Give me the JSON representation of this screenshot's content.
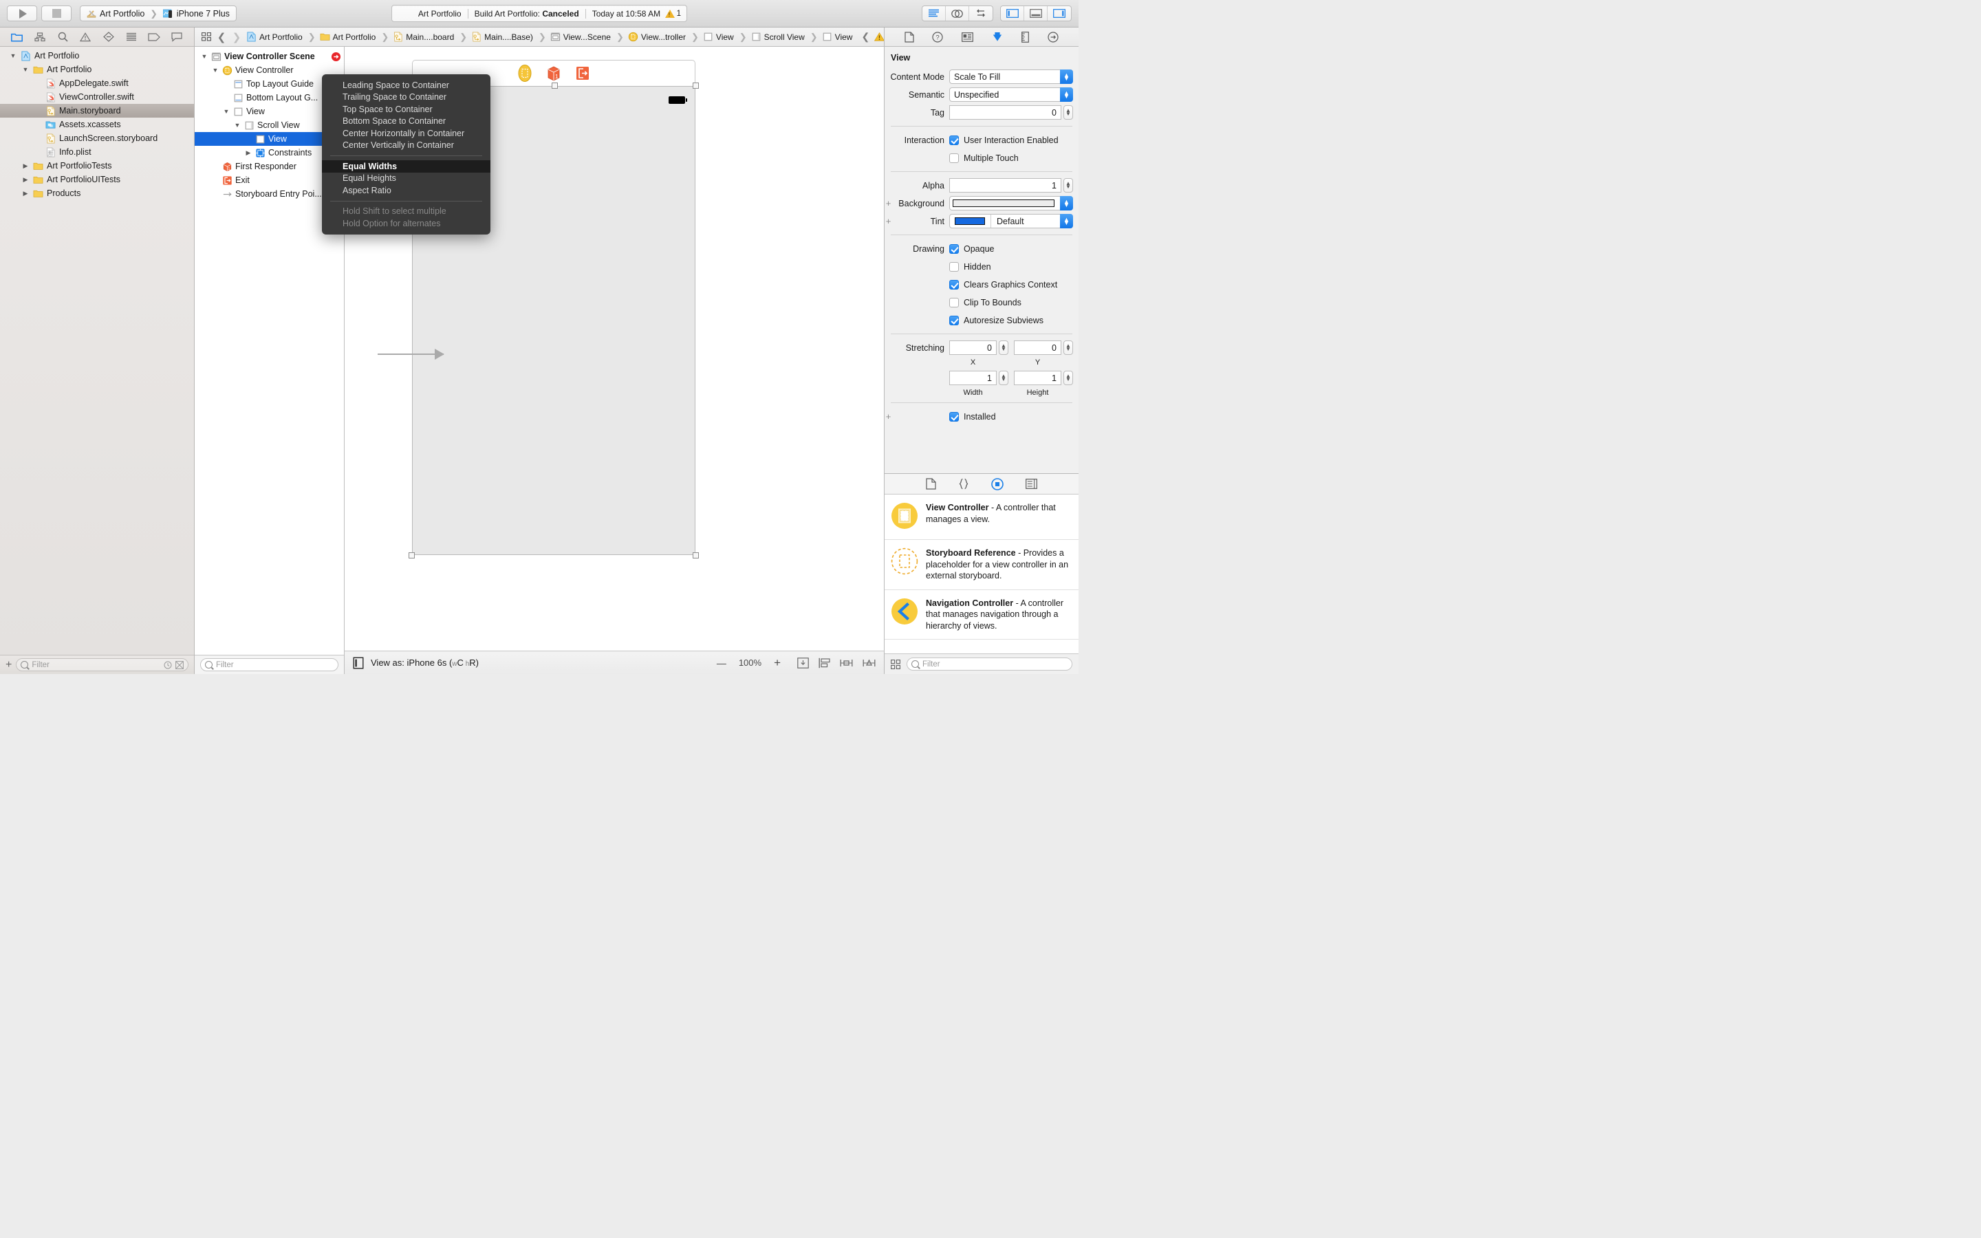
{
  "toolbar": {
    "run_button": "run",
    "stop_button": "stop",
    "scheme_name": "Art Portfolio",
    "destination_name": "iPhone 7 Plus",
    "status_project": "Art Portfolio",
    "status_build": "Build Art Portfolio: ",
    "status_build_result": "Canceled",
    "status_time": "Today at 10:58 AM",
    "warning_count": "1",
    "editor_buttons": [
      "standard-editor",
      "assistant-editor",
      "version-editor"
    ],
    "view_buttons": [
      "toggle-navigator",
      "toggle-debug-area",
      "toggle-utilities"
    ]
  },
  "navigator": {
    "tabs": [
      "project-navigator",
      "symbol-navigator",
      "find-navigator",
      "issue-navigator",
      "test-navigator",
      "debug-navigator",
      "breakpoint-navigator",
      "report-navigator"
    ],
    "items": [
      {
        "label": "Art Portfolio",
        "depth": 0,
        "disclosure": "open",
        "icon": "xcode-project",
        "selected": false
      },
      {
        "label": "Art Portfolio",
        "depth": 1,
        "disclosure": "open",
        "icon": "folder",
        "selected": false
      },
      {
        "label": "AppDelegate.swift",
        "depth": 2,
        "disclosure": "none",
        "icon": "swift",
        "selected": false
      },
      {
        "label": "ViewController.swift",
        "depth": 2,
        "disclosure": "none",
        "icon": "swift",
        "selected": false
      },
      {
        "label": "Main.storyboard",
        "depth": 2,
        "disclosure": "none",
        "icon": "storyboard",
        "selected": true
      },
      {
        "label": "Assets.xcassets",
        "depth": 2,
        "disclosure": "none",
        "icon": "xcassets",
        "selected": false
      },
      {
        "label": "LaunchScreen.storyboard",
        "depth": 2,
        "disclosure": "none",
        "icon": "storyboard",
        "selected": false
      },
      {
        "label": "Info.plist",
        "depth": 2,
        "disclosure": "none",
        "icon": "plist",
        "selected": false
      },
      {
        "label": "Art PortfolioTests",
        "depth": 1,
        "disclosure": "closed",
        "icon": "folder",
        "selected": false
      },
      {
        "label": "Art PortfolioUITests",
        "depth": 1,
        "disclosure": "closed",
        "icon": "folder",
        "selected": false
      },
      {
        "label": "Products",
        "depth": 1,
        "disclosure": "closed",
        "icon": "folder",
        "selected": false
      }
    ],
    "filter_placeholder": "Filter",
    "add_button": "+"
  },
  "jumpbar": {
    "crumbs": [
      {
        "label": "Art Portfolio",
        "icon": "xcode-project"
      },
      {
        "label": "Art Portfolio",
        "icon": "folder"
      },
      {
        "label": "Main....board",
        "icon": "storyboard"
      },
      {
        "label": "Main....Base)",
        "icon": "storyboard"
      },
      {
        "label": "View...Scene",
        "icon": "scene"
      },
      {
        "label": "View...troller",
        "icon": "view-controller"
      },
      {
        "label": "View",
        "icon": "view"
      },
      {
        "label": "Scroll View",
        "icon": "scroll-view"
      },
      {
        "label": "View",
        "icon": "view"
      }
    ],
    "warning_icon": "warning-triangle"
  },
  "outline": {
    "items": [
      {
        "label": "View Controller Scene",
        "depth": 0,
        "disclosure": "open",
        "icon": "scene",
        "bold": true,
        "selected": false,
        "badge": "entry-arrow"
      },
      {
        "label": "View Controller",
        "depth": 1,
        "disclosure": "open",
        "icon": "view-controller",
        "bold": false,
        "selected": false
      },
      {
        "label": "Top Layout Guide",
        "depth": 2,
        "disclosure": "none",
        "icon": "top-guide",
        "bold": false,
        "selected": false
      },
      {
        "label": "Bottom Layout G...",
        "depth": 2,
        "disclosure": "none",
        "icon": "bottom-guide",
        "bold": false,
        "selected": false
      },
      {
        "label": "View",
        "depth": 2,
        "disclosure": "open",
        "icon": "view",
        "bold": false,
        "selected": false
      },
      {
        "label": "Scroll View",
        "depth": 3,
        "disclosure": "open",
        "icon": "scroll-view",
        "bold": false,
        "selected": false
      },
      {
        "label": "View",
        "depth": 4,
        "disclosure": "none",
        "icon": "view",
        "bold": false,
        "selected": true
      },
      {
        "label": "Constraints",
        "depth": 4,
        "disclosure": "closed",
        "icon": "constraints",
        "bold": false,
        "selected": false
      },
      {
        "label": "First Responder",
        "depth": 1,
        "disclosure": "none",
        "icon": "first-responder",
        "bold": false,
        "selected": false
      },
      {
        "label": "Exit",
        "depth": 1,
        "disclosure": "none",
        "icon": "exit",
        "bold": false,
        "selected": false
      },
      {
        "label": "Storyboard Entry Poi...",
        "depth": 1,
        "disclosure": "none",
        "icon": "entry-point",
        "bold": false,
        "selected": false
      }
    ],
    "filter_placeholder": "Filter"
  },
  "popup_menu": {
    "groups": [
      {
        "items": [
          {
            "label": "Leading Space to Container",
            "state": "normal"
          },
          {
            "label": "Trailing Space to Container",
            "state": "normal"
          },
          {
            "label": "Top Space to Container",
            "state": "normal"
          },
          {
            "label": "Bottom Space to Container",
            "state": "normal"
          },
          {
            "label": "Center Horizontally in Container",
            "state": "normal"
          },
          {
            "label": "Center Vertically in Container",
            "state": "normal"
          }
        ]
      },
      {
        "items": [
          {
            "label": "Equal Widths",
            "state": "highlighted"
          },
          {
            "label": "Equal Heights",
            "state": "normal"
          },
          {
            "label": "Aspect Ratio",
            "state": "normal"
          }
        ]
      },
      {
        "items": [
          {
            "label": "Hold Shift to select multiple",
            "state": "disabled"
          },
          {
            "label": "Hold Option for alternates",
            "state": "disabled"
          }
        ]
      }
    ]
  },
  "canvas": {
    "scene_icons": [
      "view-controller-icon",
      "first-responder-icon",
      "exit-icon"
    ],
    "view_as_label": "View as: iPhone 6s ",
    "view_as_traits_open": "(",
    "view_as_w": "w",
    "view_as_wc": "C",
    "view_as_h": " h",
    "view_as_hr": "R",
    "view_as_traits_close": ")",
    "zoom_out": "—",
    "zoom_level": "100%",
    "zoom_in": "+",
    "align_icons": [
      "update-frames",
      "embed-in",
      "align",
      "add-constraints"
    ]
  },
  "inspector": {
    "tabs": [
      "file-inspector",
      "quick-help-inspector",
      "identity-inspector",
      "attributes-inspector",
      "size-inspector",
      "connections-inspector"
    ],
    "section_title": "View",
    "content_mode": {
      "label": "Content Mode",
      "value": "Scale To Fill"
    },
    "semantic": {
      "label": "Semantic",
      "value": "Unspecified"
    },
    "tag": {
      "label": "Tag",
      "value": "0"
    },
    "interaction": {
      "label": "Interaction",
      "user_interaction_enabled": {
        "label": "User Interaction Enabled",
        "checked": true
      },
      "multiple_touch": {
        "label": "Multiple Touch",
        "checked": false
      }
    },
    "alpha": {
      "label": "Alpha",
      "value": "1"
    },
    "background": {
      "label": "Background",
      "value": ""
    },
    "tint": {
      "label": "Tint",
      "value": "Default",
      "color": "#1569e0"
    },
    "drawing": {
      "label": "Drawing",
      "opaque": {
        "label": "Opaque",
        "checked": true
      },
      "hidden": {
        "label": "Hidden",
        "checked": false
      },
      "clears_graphics_context": {
        "label": "Clears Graphics Context",
        "checked": true
      },
      "clip_to_bounds": {
        "label": "Clip To Bounds",
        "checked": false
      },
      "autoresize_subviews": {
        "label": "Autoresize Subviews",
        "checked": true
      }
    },
    "stretching": {
      "label": "Stretching",
      "x": {
        "value": "0",
        "sub": "X"
      },
      "y": {
        "value": "0",
        "sub": "Y"
      },
      "width": {
        "value": "1",
        "sub": "Width"
      },
      "height": {
        "value": "1",
        "sub": "Height"
      }
    },
    "installed": {
      "label": "Installed",
      "checked": true
    }
  },
  "library": {
    "tabs": [
      "file-template-library",
      "code-snippet-library",
      "object-library",
      "media-library"
    ],
    "items": [
      {
        "icon": "view-controller-round",
        "title": "View Controller",
        "desc": " - A controller that manages a view."
      },
      {
        "icon": "storyboard-reference-round",
        "title": "Storyboard Reference",
        "desc": " - Provides a placeholder for a view controller in an external storyboard."
      },
      {
        "icon": "navigation-controller-round",
        "title": "Navigation Controller",
        "desc": " - A controller that manages navigation through a hierarchy of views."
      }
    ],
    "filter_placeholder": "Filter"
  }
}
